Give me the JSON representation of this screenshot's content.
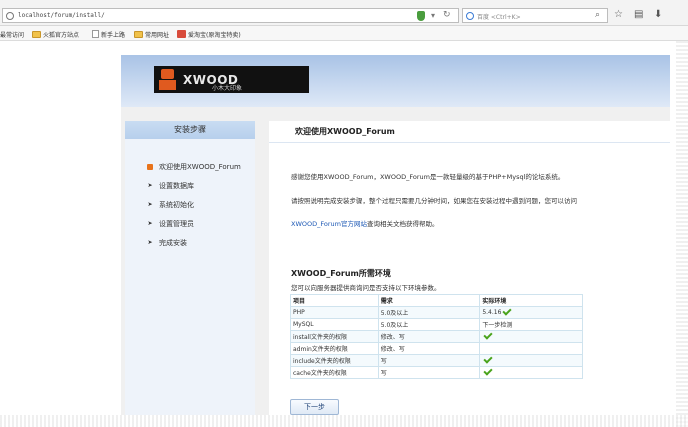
{
  "browser": {
    "url": "localhost/forum/install/",
    "search_placeholder": "百度 <Ctrl+K>",
    "bookmarks": [
      "最常访问",
      "火狐官方站点",
      "新手上路",
      "常用网址",
      "爱淘宝(原淘宝特卖)"
    ]
  },
  "logo": {
    "wordmark": "XWOOD",
    "subtitle": "小木大印象"
  },
  "sidebar": {
    "title": "安装步骤",
    "steps": [
      {
        "label": "欢迎使用XWOOD_Forum",
        "active": true
      },
      {
        "label": "设置数据库",
        "active": false
      },
      {
        "label": "系统初始化",
        "active": false
      },
      {
        "label": "设置管理员",
        "active": false
      },
      {
        "label": "完成安装",
        "active": false
      }
    ]
  },
  "main": {
    "title": "欢迎使用XWOOD_Forum",
    "intro": "感谢您使用XWOOD_Forum，XWOOD_Forum是一款轻量级的基于PHP+Mysql的论坛系统。",
    "instructions": "请按照说明完成安装步骤，整个过程只需要几分钟时间，如果您在安装过程中遇到问题，您可以访问",
    "link_text": "XWOOD_Forum官方网站",
    "link_suffix": "查询相关文档获得帮助。",
    "env_title": "XWOOD_Forum所需环境",
    "env_subtitle": "您可以向服务器提供商询问是否支持以下环境参数。",
    "table": {
      "headers": [
        "项目",
        "需求",
        "实际环境"
      ],
      "rows": [
        {
          "item": "PHP",
          "req": "5.0及以上",
          "actual": "5.4.16",
          "ok": true
        },
        {
          "item": "MySQL",
          "req": "5.0及以上",
          "actual": "下一步检测",
          "ok": false
        },
        {
          "item": "install文件夹的权限",
          "req": "修改、写",
          "actual": "",
          "ok": true
        },
        {
          "item": "admin文件夹的权限",
          "req": "修改、写",
          "actual": "",
          "ok": false
        },
        {
          "item": "include文件夹的权限",
          "req": "写",
          "actual": "",
          "ok": true
        },
        {
          "item": "cache文件夹的权限",
          "req": "写",
          "actual": "",
          "ok": true
        }
      ]
    },
    "next_label": "下一步"
  },
  "colors": {
    "accent": "#1c58b5",
    "check": "#4aa31c",
    "active_step": "#e8731b"
  }
}
